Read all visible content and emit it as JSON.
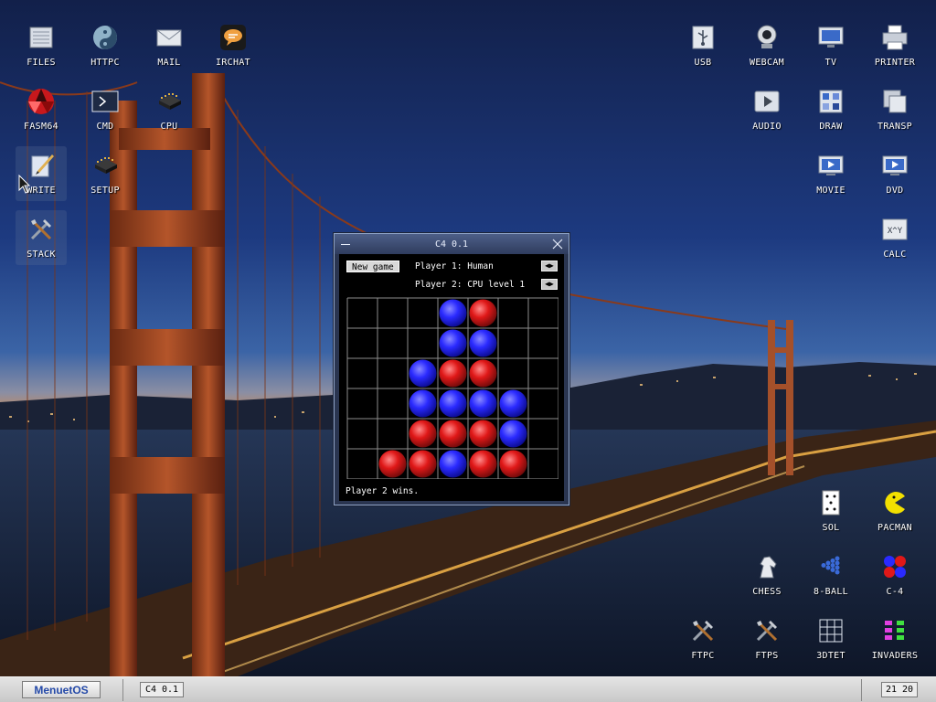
{
  "desktop": {
    "icons": [
      {
        "label": "FILES",
        "icon": "files-icon"
      },
      {
        "label": "HTTPC",
        "icon": "globe-icon"
      },
      {
        "label": "MAIL",
        "icon": "mail-icon"
      },
      {
        "label": "IRCHAT",
        "icon": "chat-bubble-icon"
      },
      {
        "label": "FASM64",
        "icon": "fasm-icon"
      },
      {
        "label": "CMD",
        "icon": "terminal-icon"
      },
      {
        "label": "CPU",
        "icon": "chip-icon"
      },
      {
        "label": "WRITE",
        "icon": "write-icon"
      },
      {
        "label": "SETUP",
        "icon": "chip-icon"
      },
      {
        "label": "STACK",
        "icon": "tools-icon"
      },
      {
        "label": "USB",
        "icon": "usb-icon"
      },
      {
        "label": "WEBCAM",
        "icon": "webcam-icon"
      },
      {
        "label": "TV",
        "icon": "tv-icon"
      },
      {
        "label": "PRINTER",
        "icon": "printer-icon"
      },
      {
        "label": "AUDIO",
        "icon": "play-icon"
      },
      {
        "label": "DRAW",
        "icon": "palette-icon"
      },
      {
        "label": "TRANSP",
        "icon": "windows-icon"
      },
      {
        "label": "MOVIE",
        "icon": "movie-icon"
      },
      {
        "label": "DVD",
        "icon": "movie-icon"
      },
      {
        "label": "CALC",
        "icon": "calc-icon"
      },
      {
        "label": "SOL",
        "icon": "card-icon"
      },
      {
        "label": "PACMAN",
        "icon": "pacman-icon"
      },
      {
        "label": "CHESS",
        "icon": "chess-knight-icon"
      },
      {
        "label": "8-BALL",
        "icon": "billiard-icon"
      },
      {
        "label": "C-4",
        "icon": "connect4-icon"
      },
      {
        "label": "FTPC",
        "icon": "tools-icon"
      },
      {
        "label": "FTPS",
        "icon": "tools-icon"
      },
      {
        "label": "3DTET",
        "icon": "grid-icon"
      },
      {
        "label": "INVADERS",
        "icon": "invaders-icon"
      }
    ]
  },
  "window": {
    "title": "C4 0.1",
    "new_game_label": "New game",
    "player1_label": "Player 1: Human",
    "player2_label": "Player 2: CPU level 1",
    "status": "Player 2 wins.",
    "board": [
      [
        "",
        "",
        "",
        "B",
        "R",
        "",
        ""
      ],
      [
        "",
        "",
        "",
        "B",
        "B",
        "",
        ""
      ],
      [
        "",
        "",
        "B",
        "R",
        "R",
        "",
        ""
      ],
      [
        "",
        "",
        "B",
        "B",
        "B",
        "B",
        ""
      ],
      [
        "",
        "",
        "R",
        "R",
        "R",
        "B",
        ""
      ],
      [
        "",
        "R",
        "R",
        "B",
        "R",
        "R",
        ""
      ]
    ]
  },
  "taskbar": {
    "menu_label": "MenuetOS",
    "task_label": "C4 0.1",
    "clock": "21 20"
  },
  "colors": {
    "player_blue": "#2a2aff",
    "player_red": "#e01818",
    "menu_text": "#2449a8"
  }
}
